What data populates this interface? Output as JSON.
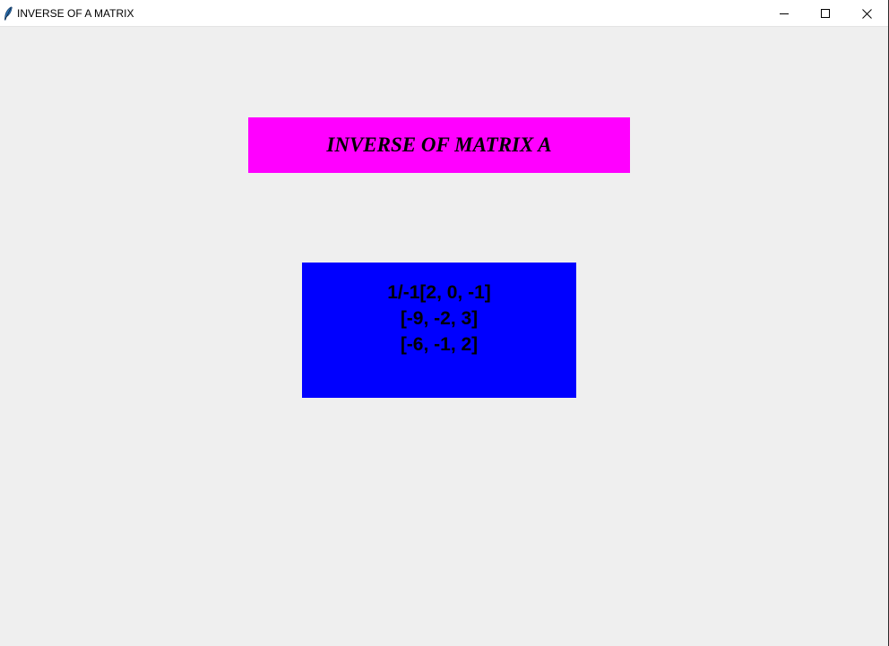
{
  "window": {
    "title": "INVERSE OF A MATRIX",
    "icon": "feather-icon",
    "controls": [
      "minimize-icon",
      "maximize-icon",
      "close-icon"
    ]
  },
  "heading": {
    "text": "INVERSE OF MATRIX A",
    "background": "#ff00ff"
  },
  "result": {
    "background": "#0000ff",
    "lines": [
      "1/-1[2, 0, -1]",
      "[-9, -2, 3]",
      "[-6, -1, 2]"
    ]
  }
}
